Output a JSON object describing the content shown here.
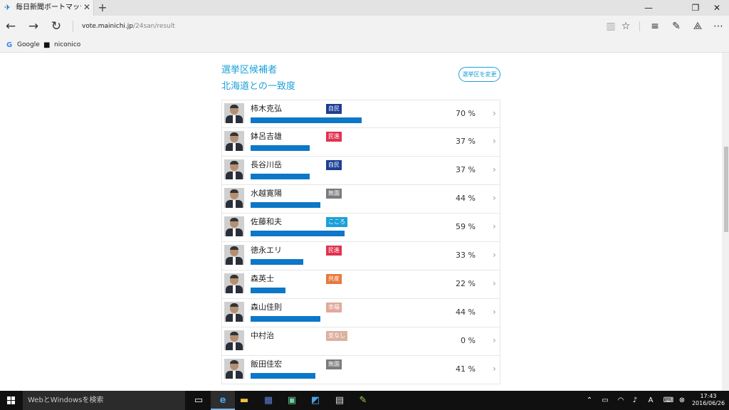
{
  "browser": {
    "tab_title": "毎日新聞ボートマッチ　えら",
    "url_domain": "vote.mainichi.jp",
    "url_path": "/24san/result",
    "favorites": [
      "Google",
      "niconico"
    ]
  },
  "page": {
    "heading_line1": "選挙区候補者",
    "heading_line2": "北海道との一致度",
    "change_button": "選挙区を変更",
    "candidates": [
      {
        "name": "柿木克弘",
        "party": "自民",
        "party_color": "#1c3f94",
        "match": 70,
        "match_label": "70 %"
      },
      {
        "name": "鉢呂吉雄",
        "party": "民進",
        "party_color": "#e0324e",
        "match": 37,
        "match_label": "37 %"
      },
      {
        "name": "長谷川岳",
        "party": "自民",
        "party_color": "#1c3f94",
        "match": 37,
        "match_label": "37 %"
      },
      {
        "name": "水越寛陽",
        "party": "無園",
        "party_color": "#7b7b7b",
        "match": 44,
        "match_label": "44 %"
      },
      {
        "name": "佐藤和夫",
        "party": "こころ",
        "party_color": "#1ba1d9",
        "match": 59,
        "match_label": "59 %"
      },
      {
        "name": "徳永エリ",
        "party": "民進",
        "party_color": "#e0324e",
        "match": 33,
        "match_label": "33 %"
      },
      {
        "name": "森英士",
        "party": "共産",
        "party_color": "#e8783c",
        "match": 22,
        "match_label": "22 %"
      },
      {
        "name": "森山佳則",
        "party": "幸福",
        "party_color": "#e2a89a",
        "match": 44,
        "match_label": "44 %"
      },
      {
        "name": "中村治",
        "party": "支なし",
        "party_color": "#dcb1a0",
        "match": 0,
        "match_label": "0 %"
      },
      {
        "name": "飯田佳宏",
        "party": "無園",
        "party_color": "#7b7b7b",
        "match": 41,
        "match_label": "41 %"
      }
    ]
  },
  "taskbar": {
    "search_placeholder": "WebとWindowsを検索",
    "time": "17:43",
    "date": "2016/06/26"
  }
}
